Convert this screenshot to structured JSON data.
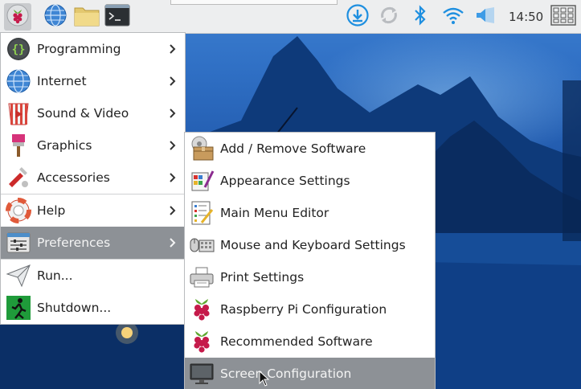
{
  "taskbar": {
    "clock": "14:50",
    "launchers": [
      {
        "name": "raspberry-menu",
        "icon": "raspberry-icon"
      },
      {
        "name": "web-browser",
        "icon": "globe-icon"
      },
      {
        "name": "file-manager",
        "icon": "folder-icon"
      },
      {
        "name": "terminal",
        "icon": "terminal-icon"
      }
    ],
    "tray": [
      {
        "name": "updates",
        "icon": "download-icon"
      },
      {
        "name": "sync",
        "icon": "sync-icon"
      },
      {
        "name": "bluetooth",
        "icon": "bluetooth-icon"
      },
      {
        "name": "wifi",
        "icon": "wifi-icon"
      },
      {
        "name": "volume",
        "icon": "volume-icon"
      }
    ]
  },
  "menu": {
    "items": [
      {
        "label": "Programming",
        "icon": "programming-icon",
        "submenu": true
      },
      {
        "label": "Internet",
        "icon": "internet-icon",
        "submenu": true
      },
      {
        "label": "Sound & Video",
        "icon": "sound-video-icon",
        "submenu": true
      },
      {
        "label": "Graphics",
        "icon": "graphics-icon",
        "submenu": true
      },
      {
        "label": "Accessories",
        "icon": "accessories-icon",
        "submenu": true
      },
      {
        "label": "Help",
        "icon": "help-icon",
        "submenu": true
      },
      {
        "label": "Preferences",
        "icon": "preferences-icon",
        "submenu": true,
        "highlighted": true
      },
      {
        "label": "Run...",
        "icon": "run-icon",
        "submenu": false
      },
      {
        "label": "Shutdown...",
        "icon": "shutdown-icon",
        "submenu": false
      }
    ]
  },
  "submenu": {
    "items": [
      {
        "label": "Add / Remove Software",
        "icon": "package-icon"
      },
      {
        "label": "Appearance Settings",
        "icon": "appearance-icon"
      },
      {
        "label": "Main Menu Editor",
        "icon": "menu-editor-icon"
      },
      {
        "label": "Mouse and Keyboard Settings",
        "icon": "mouse-keyboard-icon"
      },
      {
        "label": "Print Settings",
        "icon": "printer-icon"
      },
      {
        "label": "Raspberry Pi Configuration",
        "icon": "raspberry-icon"
      },
      {
        "label": "Recommended Software",
        "icon": "raspberry-icon"
      },
      {
        "label": "Screen Configuration",
        "icon": "monitor-icon",
        "highlighted": true
      }
    ]
  },
  "colors": {
    "taskbar_bg": "#edeeef",
    "menu_bg": "#ffffff",
    "highlight_bg": "#8d9196",
    "highlight_text": "#f4f4f4",
    "tray_accent": "#1e8fe0"
  }
}
